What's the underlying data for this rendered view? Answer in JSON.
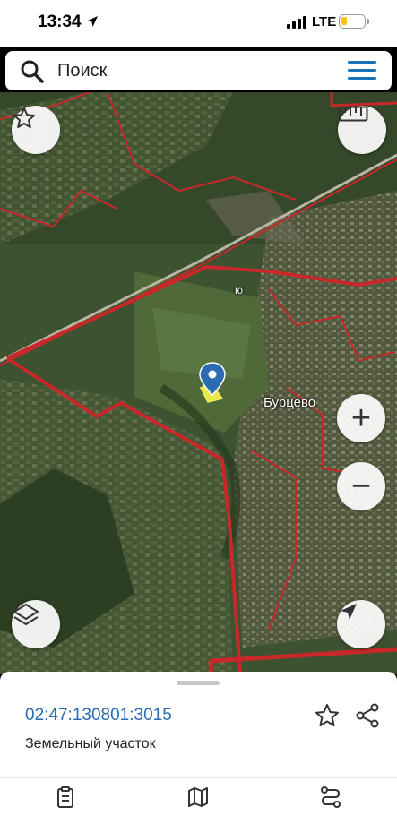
{
  "status_bar": {
    "time": "13:34",
    "network": "LTE",
    "battery_level": 0.25
  },
  "search": {
    "placeholder": "Поиск"
  },
  "map": {
    "labels": {
      "village": "Бурцево",
      "road_marker": "ю"
    },
    "buttons": {
      "favorites": "star-icon",
      "ruler": "ruler-icon",
      "zoom_in": "+",
      "zoom_out": "−",
      "layers": "layers-icon",
      "locate": "location-arrow-icon"
    }
  },
  "parcel": {
    "cadastral_number": "02:47:130801:3015",
    "type": "Земельный участок"
  },
  "tabs": [
    {
      "icon": "clipboard-icon"
    },
    {
      "icon": "map-icon"
    },
    {
      "icon": "route-icon"
    }
  ],
  "colors": {
    "accent": "#2b6bb2",
    "boundary": "#c8282a",
    "parcel_fill": "#e8e84a",
    "pin": "#2b6bb2"
  }
}
